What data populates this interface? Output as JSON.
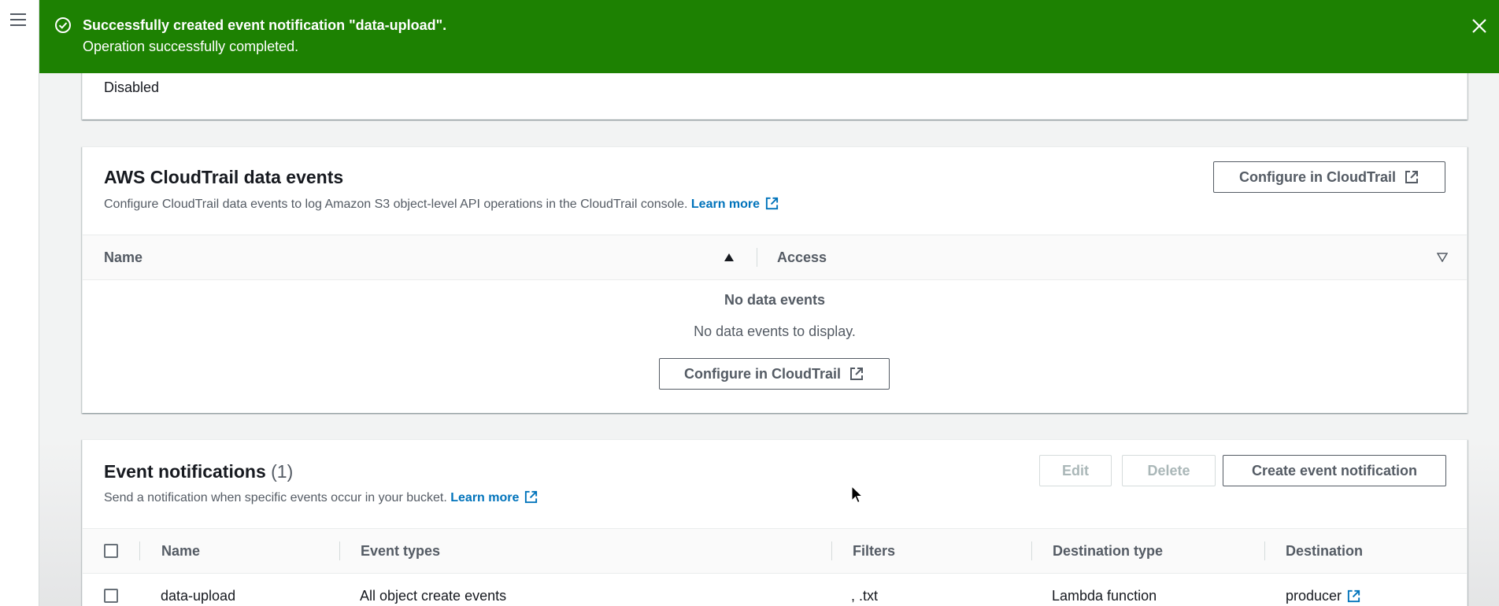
{
  "flash": {
    "title": "Successfully created event notification \"data-upload\".",
    "message": "Operation successfully completed.",
    "color": "#1d8102"
  },
  "top_panel": {
    "value": "Disabled"
  },
  "cloudtrail": {
    "title": "AWS CloudTrail data events",
    "description": "Configure CloudTrail data events to log Amazon S3 object-level API operations in the CloudTrail console.",
    "learn_more": "Learn more",
    "configure_button": "Configure in CloudTrail",
    "columns": [
      "Name",
      "Access"
    ],
    "empty_title": "No data events",
    "empty_desc": "No data events to display.",
    "empty_button": "Configure in CloudTrail"
  },
  "event_notifications": {
    "title": "Event notifications",
    "count": "(1)",
    "description": "Send a notification when specific events occur in your bucket.",
    "learn_more": "Learn more",
    "edit_button": "Edit",
    "delete_button": "Delete",
    "create_button": "Create event notification",
    "columns": [
      "Name",
      "Event types",
      "Filters",
      "Destination type",
      "Destination"
    ],
    "rows": [
      {
        "name": "data-upload",
        "event_types": "All object create events",
        "filters": ", .txt",
        "destination_type": "Lambda function",
        "destination": "producer"
      }
    ]
  },
  "colors": {
    "link": "#0073bb",
    "success": "#1d8102"
  }
}
